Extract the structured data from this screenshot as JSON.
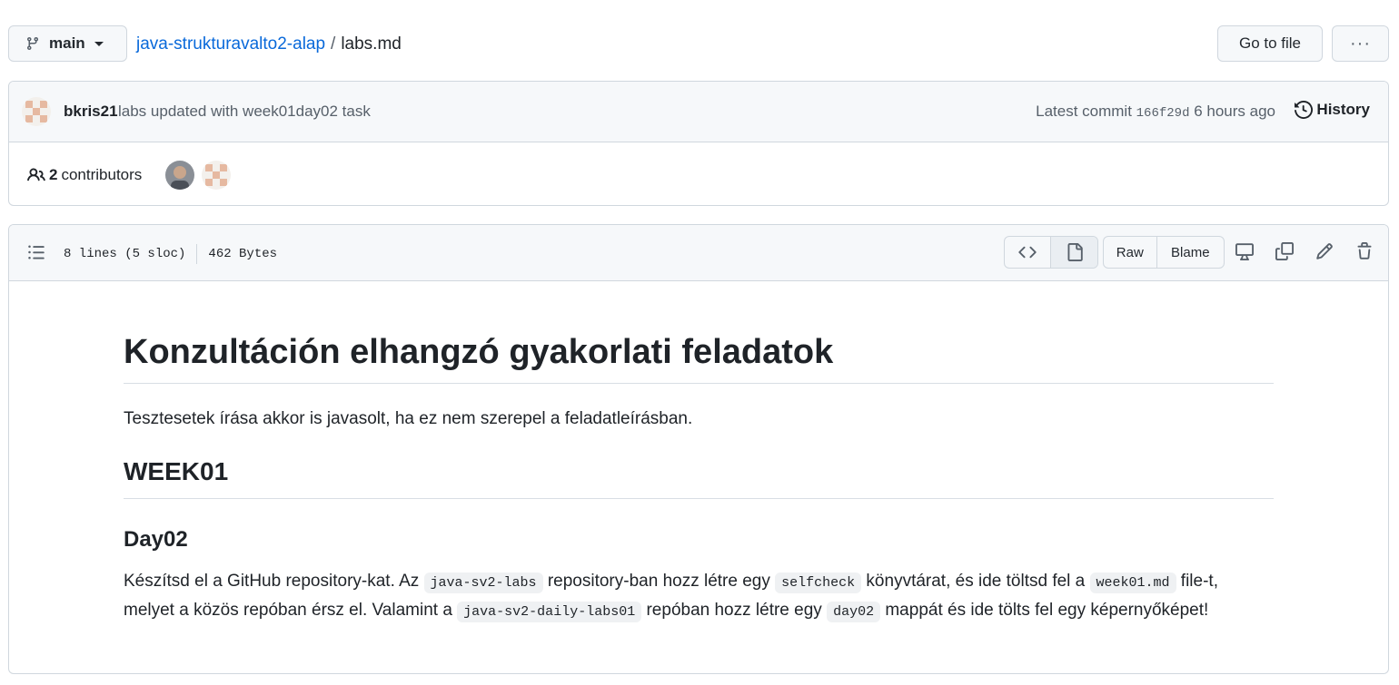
{
  "branch": {
    "name": "main"
  },
  "breadcrumb": {
    "repo": "java-strukturavalto2-alap",
    "separator": "/",
    "file": "labs.md"
  },
  "actions": {
    "go_to_file": "Go to file",
    "more": "···"
  },
  "commit": {
    "author": "bkris21",
    "message": "labs updated with week01day02 task",
    "latest_label": "Latest commit",
    "sha": "166f29d",
    "time": "6 hours ago",
    "history_label": "History"
  },
  "contributors": {
    "count": "2",
    "label": "contributors"
  },
  "file_header": {
    "lines": "8 lines (5 sloc)",
    "size": "462 Bytes",
    "raw_label": "Raw",
    "blame_label": "Blame"
  },
  "readme": {
    "h1": "Konzultáción elhangzó gyakorlati feladatok",
    "intro": "Tesztesetek írása akkor is javasolt, ha ez nem szerepel a feladatleírásban.",
    "h2": "WEEK01",
    "h3": "Day02",
    "p": {
      "t1": "Készítsd el a GitHub repository-kat. Az ",
      "c1": "java-sv2-labs",
      "t2": " repository-ban hozz létre egy ",
      "c2": "selfcheck",
      "t3": " könyvtárat, és ide töltsd fel a ",
      "c3": "week01.md",
      "t4": " file-t, melyet a közös repóban érsz el. Valamint a ",
      "c4": "java-sv2-daily-labs01",
      "t5": " repóban hozz létre egy ",
      "c5": "day02",
      "t6": " mappát és ide tölts fel egy képernyőképet!"
    }
  },
  "colors": {
    "link": "#0969da",
    "border": "#d0d7de",
    "header_bg": "#f6f8fa",
    "muted": "#57606a"
  },
  "icons": [
    "git-branch-icon",
    "caret-down-icon",
    "history-icon",
    "people-icon",
    "list-icon",
    "code-icon",
    "file-icon",
    "desktop-icon",
    "copy-icon",
    "pencil-icon",
    "trash-icon"
  ]
}
